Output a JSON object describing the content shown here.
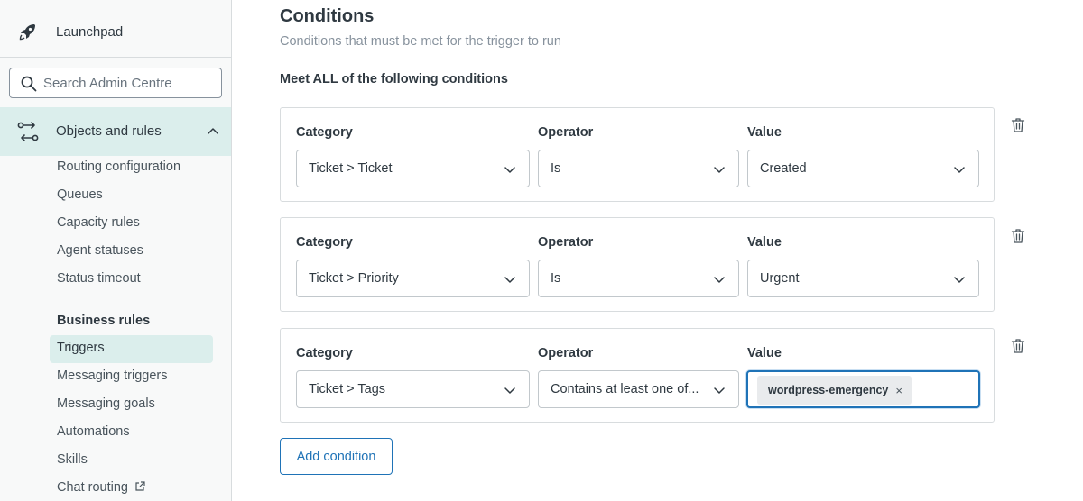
{
  "sidebar": {
    "launchpad_label": "Launchpad",
    "search_placeholder": "Search Admin Centre",
    "section_label": "Objects and rules",
    "items": [
      "Routing configuration",
      "Queues",
      "Capacity rules",
      "Agent statuses",
      "Status timeout"
    ],
    "group_label": "Business rules",
    "group_items": [
      "Triggers",
      "Messaging triggers",
      "Messaging goals",
      "Automations",
      "Skills",
      "Chat routing"
    ],
    "selected_item": "Triggers"
  },
  "main": {
    "title": "Conditions",
    "subtitle": "Conditions that must be met for the trigger to run",
    "meet_label": "Meet ALL of the following conditions",
    "col_category": "Category",
    "col_operator": "Operator",
    "col_value": "Value",
    "conditions": [
      {
        "category": "Ticket > Ticket",
        "operator": "Is",
        "value": "Created"
      },
      {
        "category": "Ticket > Priority",
        "operator": "Is",
        "value": "Urgent"
      },
      {
        "category": "Ticket > Tags",
        "operator": "Contains at least one of...",
        "tag": "wordpress-emergency",
        "tag_remove": "×"
      }
    ],
    "add_condition_label": "Add condition"
  },
  "colors": {
    "accent": "#1f73b7",
    "selected_bg": "#dbeeec",
    "border": "#d8dcde"
  },
  "icons": {
    "launchpad": "rocket-icon",
    "search": "search-icon",
    "section": "objects-rules-icon",
    "collapse": "chevron-up-icon",
    "dropdown": "chevron-down-icon",
    "delete": "trash-icon",
    "external": "external-link-icon"
  }
}
